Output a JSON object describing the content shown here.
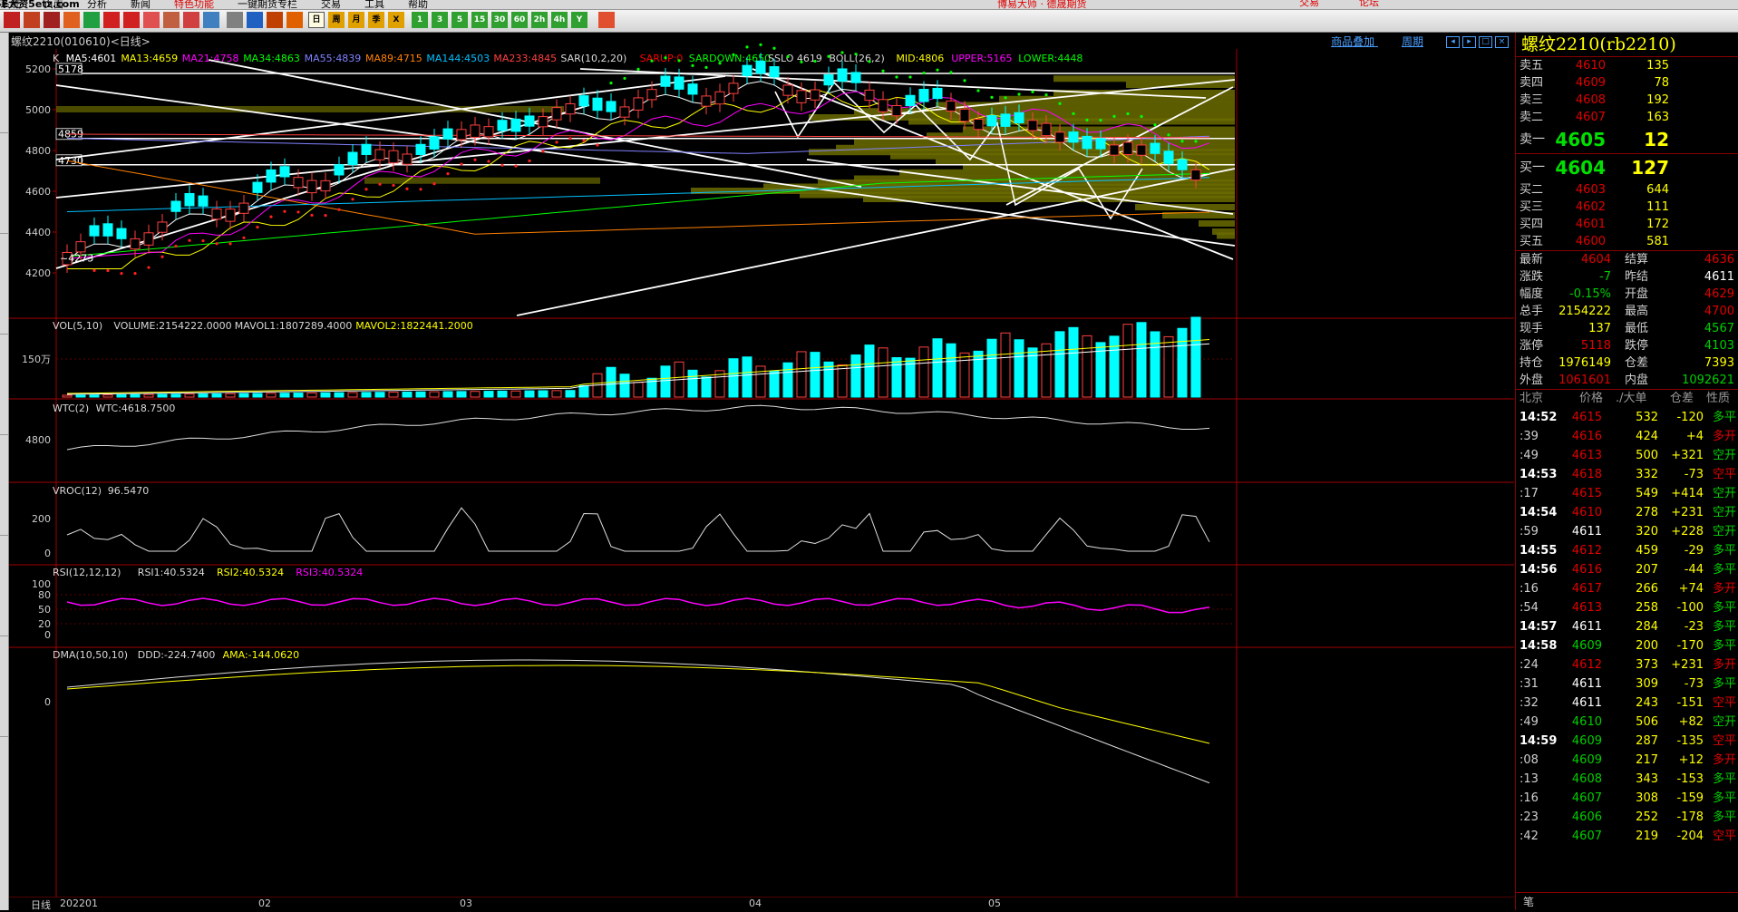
{
  "menu": {
    "items": [
      "系统",
      "页面",
      "分析",
      "新闻",
      "特色功能",
      "一键期货专栏",
      "交易",
      "工具",
      "帮助"
    ],
    "center": "博易大师 · 德晟期货",
    "trade": "交易",
    "forum": "论坛",
    "brand": "5E大资5etz.com"
  },
  "chart": {
    "title": "螺纹2210(010610)<日线>",
    "links": [
      "商品叠加",
      "周期"
    ],
    "indicator_line": [
      {
        "t": "K",
        "c": "#d8d8d8"
      },
      {
        "t": "MA5:4601",
        "c": "#ffffff"
      },
      {
        "t": "MA13:4659",
        "c": "#ffff00"
      },
      {
        "t": "MA21:4758",
        "c": "#ff00ff"
      },
      {
        "t": "MA34:4863",
        "c": "#00ff00"
      },
      {
        "t": "MA55:4839",
        "c": "#8080ff"
      },
      {
        "t": "MA89:4715",
        "c": "#ff8000"
      },
      {
        "t": "MA144:4503",
        "c": "#00c0ff"
      },
      {
        "t": "MA233:4845",
        "c": "#ff4040"
      },
      {
        "t": "SAR(10,2,20)",
        "c": "#d8d8d8"
      },
      {
        "t": "SARUP:0",
        "c": "#ff0000"
      },
      {
        "t": "SARDOWN:4650",
        "c": "#00ff00"
      },
      {
        "t": "SSLO 4619",
        "c": "#d8d8d8"
      },
      {
        "t": "BOLL(26,2)",
        "c": "#d8d8d8"
      },
      {
        "t": "MID:4806",
        "c": "#ffff00"
      },
      {
        "t": "UPPER:5165",
        "c": "#ff00ff"
      },
      {
        "t": "LOWER:4448",
        "c": "#00ff00"
      }
    ],
    "y_labels": [
      "5200",
      "5000",
      "4800",
      "4600",
      "4400",
      "4200"
    ],
    "boxed_levels": [
      "5178",
      "4859",
      "4730"
    ],
    "low_label": "4273",
    "vol": {
      "header": [
        {
          "t": "VOL(5,10)",
          "c": "#d8d8d8"
        },
        {
          "t": "VOLUME:2154222.0000",
          "c": "#d8d8d8"
        },
        {
          "t": "MAVOL1:1807289.4000",
          "c": "#d8d8d8"
        },
        {
          "t": "MAVOL2:1822441.2000",
          "c": "#ffff00"
        }
      ],
      "y_label": "150万"
    },
    "wtc": {
      "header": [
        {
          "t": "WTC(2)",
          "c": "#d8d8d8"
        },
        {
          "t": "WTC:4618.7500",
          "c": "#d8d8d8"
        }
      ],
      "y_label": "4800"
    },
    "vroc": {
      "header": [
        {
          "t": "VROC(12)",
          "c": "#d8d8d8"
        },
        {
          "t": "96.5470",
          "c": "#d8d8d8"
        }
      ],
      "y_labels": [
        "200",
        "0"
      ]
    },
    "rsi": {
      "header": [
        {
          "t": "RSI(12,12,12)",
          "c": "#d8d8d8"
        },
        {
          "t": "RSI1:40.5324",
          "c": "#d8d8d8"
        },
        {
          "t": "RSI2:40.5324",
          "c": "#ffff00"
        },
        {
          "t": "RSI3:40.5324",
          "c": "#ff00ff"
        }
      ],
      "y_labels": [
        "100",
        "80",
        "50",
        "20",
        "0"
      ]
    },
    "dma": {
      "header": [
        {
          "t": "DMA(10,50,10)",
          "c": "#d8d8d8"
        },
        {
          "t": "DDD:-224.7400",
          "c": "#d8d8d8"
        },
        {
          "t": "AMA:-144.0620",
          "c": "#ffff00"
        }
      ],
      "y_label": "0"
    },
    "x_axis": {
      "period": "日线",
      "labels": [
        "202201",
        "02",
        "03",
        "04",
        "05"
      ]
    }
  },
  "quote": {
    "title": "螺纹2210(rb2210)",
    "asks": [
      {
        "label": "卖五",
        "price": "4610",
        "vol": "135"
      },
      {
        "label": "卖四",
        "price": "4609",
        "vol": "78"
      },
      {
        "label": "卖三",
        "price": "4608",
        "vol": "192"
      },
      {
        "label": "卖二",
        "price": "4607",
        "vol": "163"
      },
      {
        "label": "卖一",
        "price": "4605",
        "vol": "12"
      }
    ],
    "bids": [
      {
        "label": "买一",
        "price": "4604",
        "vol": "127"
      },
      {
        "label": "买二",
        "price": "4603",
        "vol": "644"
      },
      {
        "label": "买三",
        "price": "4602",
        "vol": "111"
      },
      {
        "label": "买四",
        "price": "4601",
        "vol": "172"
      },
      {
        "label": "买五",
        "price": "4600",
        "vol": "581"
      }
    ],
    "stats": [
      {
        "l1": "最新",
        "v1": "4604",
        "c1": "red",
        "l2": "结算",
        "v2": "4636",
        "c2": "red"
      },
      {
        "l1": "涨跌",
        "v1": "-7",
        "c1": "grn",
        "l2": "昨结",
        "v2": "4611",
        "c2": "wht"
      },
      {
        "l1": "幅度",
        "v1": "-0.15%",
        "c1": "grn",
        "l2": "开盘",
        "v2": "4629",
        "c2": "red"
      },
      {
        "l1": "总手",
        "v1": "2154222",
        "c1": "yel",
        "l2": "最高",
        "v2": "4700",
        "c2": "red"
      },
      {
        "l1": "现手",
        "v1": "137",
        "c1": "yel",
        "l2": "最低",
        "v2": "4567",
        "c2": "grn"
      },
      {
        "l1": "涨停",
        "v1": "5118",
        "c1": "red",
        "l2": "跌停",
        "v2": "4103",
        "c2": "grn"
      },
      {
        "l1": "持仓",
        "v1": "1976149",
        "c1": "yel",
        "l2": "仓差",
        "v2": "7393",
        "c2": "yel"
      },
      {
        "l1": "外盘",
        "v1": "1061601",
        "c1": "red",
        "l2": "内盘",
        "v2": "1092621",
        "c2": "grn"
      }
    ],
    "tick_header": {
      "time": "北京",
      "price": "价格",
      "vol": "./大单",
      "diff": "仓差",
      "nature": "性质"
    },
    "ticks": [
      {
        "t": "14:52",
        "b": true,
        "p": "4615",
        "pc": "red",
        "v": "532",
        "d": "-120",
        "dc": "yel",
        "n": "多平",
        "nc": "grn"
      },
      {
        "t": ":39",
        "b": false,
        "p": "4616",
        "pc": "red",
        "v": "424",
        "d": "+4",
        "dc": "yel",
        "n": "多开",
        "nc": "red"
      },
      {
        "t": ":49",
        "b": false,
        "p": "4613",
        "pc": "red",
        "v": "500",
        "d": "+321",
        "dc": "yel",
        "n": "空开",
        "nc": "grn"
      },
      {
        "t": "14:53",
        "b": true,
        "p": "4618",
        "pc": "red",
        "v": "332",
        "d": "-73",
        "dc": "yel",
        "n": "空平",
        "nc": "red"
      },
      {
        "t": ":17",
        "b": false,
        "p": "4615",
        "pc": "red",
        "v": "549",
        "d": "+414",
        "dc": "yel",
        "n": "空开",
        "nc": "grn"
      },
      {
        "t": "14:54",
        "b": true,
        "p": "4610",
        "pc": "red",
        "v": "278",
        "d": "+231",
        "dc": "yel",
        "n": "空开",
        "nc": "grn"
      },
      {
        "t": ":59",
        "b": false,
        "p": "4611",
        "pc": "wht",
        "v": "320",
        "d": "+228",
        "dc": "yel",
        "n": "空开",
        "nc": "grn"
      },
      {
        "t": "14:55",
        "b": true,
        "p": "4612",
        "pc": "red",
        "v": "459",
        "d": "-29",
        "dc": "yel",
        "n": "多平",
        "nc": "grn"
      },
      {
        "t": "14:56",
        "b": true,
        "p": "4616",
        "pc": "red",
        "v": "207",
        "d": "-44",
        "dc": "yel",
        "n": "多平",
        "nc": "grn"
      },
      {
        "t": ":16",
        "b": false,
        "p": "4617",
        "pc": "red",
        "v": "266",
        "d": "+74",
        "dc": "yel",
        "n": "多开",
        "nc": "red"
      },
      {
        "t": ":54",
        "b": false,
        "p": "4613",
        "pc": "red",
        "v": "258",
        "d": "-100",
        "dc": "yel",
        "n": "多平",
        "nc": "grn"
      },
      {
        "t": "14:57",
        "b": true,
        "p": "4611",
        "pc": "wht",
        "v": "284",
        "d": "-23",
        "dc": "yel",
        "n": "多平",
        "nc": "grn"
      },
      {
        "t": "14:58",
        "b": true,
        "p": "4609",
        "pc": "grn",
        "v": "200",
        "d": "-170",
        "dc": "yel",
        "n": "多平",
        "nc": "grn"
      },
      {
        "t": ":24",
        "b": false,
        "p": "4612",
        "pc": "red",
        "v": "373",
        "d": "+231",
        "dc": "yel",
        "n": "多开",
        "nc": "red"
      },
      {
        "t": ":31",
        "b": false,
        "p": "4611",
        "pc": "wht",
        "v": "309",
        "d": "-73",
        "dc": "yel",
        "n": "多平",
        "nc": "grn"
      },
      {
        "t": ":32",
        "b": false,
        "p": "4611",
        "pc": "wht",
        "v": "243",
        "d": "-151",
        "dc": "yel",
        "n": "空平",
        "nc": "red"
      },
      {
        "t": ":49",
        "b": false,
        "p": "4610",
        "pc": "grn",
        "v": "506",
        "d": "+82",
        "dc": "yel",
        "n": "空开",
        "nc": "grn"
      },
      {
        "t": "14:59",
        "b": true,
        "p": "4609",
        "pc": "grn",
        "v": "287",
        "d": "-135",
        "dc": "yel",
        "n": "空平",
        "nc": "red"
      },
      {
        "t": ":08",
        "b": false,
        "p": "4609",
        "pc": "grn",
        "v": "217",
        "d": "+12",
        "dc": "yel",
        "n": "多开",
        "nc": "red"
      },
      {
        "t": ":13",
        "b": false,
        "p": "4608",
        "pc": "grn",
        "v": "343",
        "d": "-153",
        "dc": "yel",
        "n": "多平",
        "nc": "grn"
      },
      {
        "t": ":16",
        "b": false,
        "p": "4607",
        "pc": "grn",
        "v": "308",
        "d": "-159",
        "dc": "yel",
        "n": "多平",
        "nc": "grn"
      },
      {
        "t": ":23",
        "b": false,
        "p": "4606",
        "pc": "grn",
        "v": "252",
        "d": "-178",
        "dc": "yel",
        "n": "多平",
        "nc": "grn"
      },
      {
        "t": ":42",
        "b": false,
        "p": "4607",
        "pc": "grn",
        "v": "219",
        "d": "-204",
        "dc": "yel",
        "n": "空平",
        "nc": "red"
      }
    ],
    "footer": "笔"
  }
}
